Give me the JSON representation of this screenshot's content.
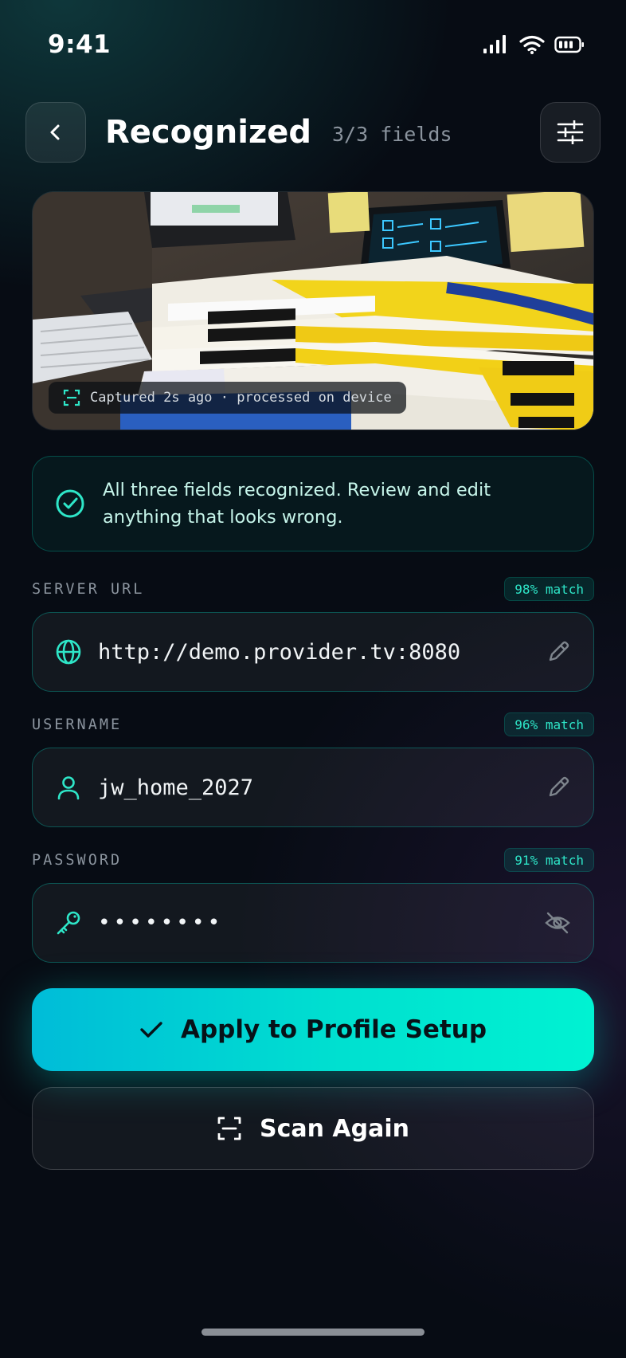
{
  "status_bar": {
    "time": "9:41"
  },
  "header": {
    "title": "Recognized",
    "field_count": "3/3 fields"
  },
  "photo": {
    "caption": "Captured 2s ago · processed on device"
  },
  "notice": {
    "text": "All three fields recognized. Review and edit anything that looks wrong."
  },
  "fields": [
    {
      "label": "SERVER URL",
      "match": "98% match",
      "value": "http://demo.provider.tv:8080",
      "icon": "globe-icon",
      "action_icon": "pencil-icon"
    },
    {
      "label": "USERNAME",
      "match": "96% match",
      "value": "jw_home_2027",
      "icon": "user-icon",
      "action_icon": "pencil-icon"
    },
    {
      "label": "PASSWORD",
      "match": "91% match",
      "value": "••••••••",
      "icon": "key-icon",
      "action_icon": "eye-off-icon"
    }
  ],
  "actions": {
    "primary_label": "Apply to Profile Setup",
    "secondary_label": "Scan Again"
  },
  "colors": {
    "accent": "#00e0d0",
    "accent_start": "#00bcd8",
    "background": "#070c14"
  }
}
